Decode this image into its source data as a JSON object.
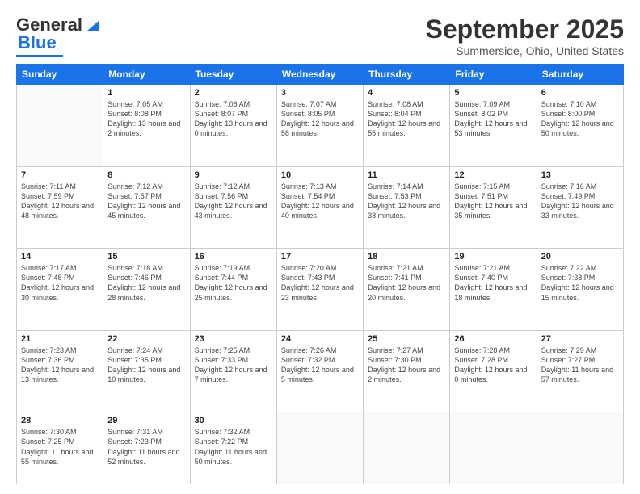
{
  "logo": {
    "line1": "General",
    "line2": "Blue"
  },
  "header": {
    "month": "September 2025",
    "location": "Summerside, Ohio, United States"
  },
  "days": [
    "Sunday",
    "Monday",
    "Tuesday",
    "Wednesday",
    "Thursday",
    "Friday",
    "Saturday"
  ],
  "weeks": [
    [
      {
        "num": "",
        "sunrise": "",
        "sunset": "",
        "daylight": ""
      },
      {
        "num": "1",
        "sunrise": "Sunrise: 7:05 AM",
        "sunset": "Sunset: 8:08 PM",
        "daylight": "Daylight: 13 hours and 2 minutes."
      },
      {
        "num": "2",
        "sunrise": "Sunrise: 7:06 AM",
        "sunset": "Sunset: 8:07 PM",
        "daylight": "Daylight: 13 hours and 0 minutes."
      },
      {
        "num": "3",
        "sunrise": "Sunrise: 7:07 AM",
        "sunset": "Sunset: 8:05 PM",
        "daylight": "Daylight: 12 hours and 58 minutes."
      },
      {
        "num": "4",
        "sunrise": "Sunrise: 7:08 AM",
        "sunset": "Sunset: 8:04 PM",
        "daylight": "Daylight: 12 hours and 55 minutes."
      },
      {
        "num": "5",
        "sunrise": "Sunrise: 7:09 AM",
        "sunset": "Sunset: 8:02 PM",
        "daylight": "Daylight: 12 hours and 53 minutes."
      },
      {
        "num": "6",
        "sunrise": "Sunrise: 7:10 AM",
        "sunset": "Sunset: 8:00 PM",
        "daylight": "Daylight: 12 hours and 50 minutes."
      }
    ],
    [
      {
        "num": "7",
        "sunrise": "Sunrise: 7:11 AM",
        "sunset": "Sunset: 7:59 PM",
        "daylight": "Daylight: 12 hours and 48 minutes."
      },
      {
        "num": "8",
        "sunrise": "Sunrise: 7:12 AM",
        "sunset": "Sunset: 7:57 PM",
        "daylight": "Daylight: 12 hours and 45 minutes."
      },
      {
        "num": "9",
        "sunrise": "Sunrise: 7:12 AM",
        "sunset": "Sunset: 7:56 PM",
        "daylight": "Daylight: 12 hours and 43 minutes."
      },
      {
        "num": "10",
        "sunrise": "Sunrise: 7:13 AM",
        "sunset": "Sunset: 7:54 PM",
        "daylight": "Daylight: 12 hours and 40 minutes."
      },
      {
        "num": "11",
        "sunrise": "Sunrise: 7:14 AM",
        "sunset": "Sunset: 7:53 PM",
        "daylight": "Daylight: 12 hours and 38 minutes."
      },
      {
        "num": "12",
        "sunrise": "Sunrise: 7:15 AM",
        "sunset": "Sunset: 7:51 PM",
        "daylight": "Daylight: 12 hours and 35 minutes."
      },
      {
        "num": "13",
        "sunrise": "Sunrise: 7:16 AM",
        "sunset": "Sunset: 7:49 PM",
        "daylight": "Daylight: 12 hours and 33 minutes."
      }
    ],
    [
      {
        "num": "14",
        "sunrise": "Sunrise: 7:17 AM",
        "sunset": "Sunset: 7:48 PM",
        "daylight": "Daylight: 12 hours and 30 minutes."
      },
      {
        "num": "15",
        "sunrise": "Sunrise: 7:18 AM",
        "sunset": "Sunset: 7:46 PM",
        "daylight": "Daylight: 12 hours and 28 minutes."
      },
      {
        "num": "16",
        "sunrise": "Sunrise: 7:19 AM",
        "sunset": "Sunset: 7:44 PM",
        "daylight": "Daylight: 12 hours and 25 minutes."
      },
      {
        "num": "17",
        "sunrise": "Sunrise: 7:20 AM",
        "sunset": "Sunset: 7:43 PM",
        "daylight": "Daylight: 12 hours and 23 minutes."
      },
      {
        "num": "18",
        "sunrise": "Sunrise: 7:21 AM",
        "sunset": "Sunset: 7:41 PM",
        "daylight": "Daylight: 12 hours and 20 minutes."
      },
      {
        "num": "19",
        "sunrise": "Sunrise: 7:21 AM",
        "sunset": "Sunset: 7:40 PM",
        "daylight": "Daylight: 12 hours and 18 minutes."
      },
      {
        "num": "20",
        "sunrise": "Sunrise: 7:22 AM",
        "sunset": "Sunset: 7:38 PM",
        "daylight": "Daylight: 12 hours and 15 minutes."
      }
    ],
    [
      {
        "num": "21",
        "sunrise": "Sunrise: 7:23 AM",
        "sunset": "Sunset: 7:36 PM",
        "daylight": "Daylight: 12 hours and 13 minutes."
      },
      {
        "num": "22",
        "sunrise": "Sunrise: 7:24 AM",
        "sunset": "Sunset: 7:35 PM",
        "daylight": "Daylight: 12 hours and 10 minutes."
      },
      {
        "num": "23",
        "sunrise": "Sunrise: 7:25 AM",
        "sunset": "Sunset: 7:33 PM",
        "daylight": "Daylight: 12 hours and 7 minutes."
      },
      {
        "num": "24",
        "sunrise": "Sunrise: 7:26 AM",
        "sunset": "Sunset: 7:32 PM",
        "daylight": "Daylight: 12 hours and 5 minutes."
      },
      {
        "num": "25",
        "sunrise": "Sunrise: 7:27 AM",
        "sunset": "Sunset: 7:30 PM",
        "daylight": "Daylight: 12 hours and 2 minutes."
      },
      {
        "num": "26",
        "sunrise": "Sunrise: 7:28 AM",
        "sunset": "Sunset: 7:28 PM",
        "daylight": "Daylight: 12 hours and 0 minutes."
      },
      {
        "num": "27",
        "sunrise": "Sunrise: 7:29 AM",
        "sunset": "Sunset: 7:27 PM",
        "daylight": "Daylight: 11 hours and 57 minutes."
      }
    ],
    [
      {
        "num": "28",
        "sunrise": "Sunrise: 7:30 AM",
        "sunset": "Sunset: 7:25 PM",
        "daylight": "Daylight: 11 hours and 55 minutes."
      },
      {
        "num": "29",
        "sunrise": "Sunrise: 7:31 AM",
        "sunset": "Sunset: 7:23 PM",
        "daylight": "Daylight: 11 hours and 52 minutes."
      },
      {
        "num": "30",
        "sunrise": "Sunrise: 7:32 AM",
        "sunset": "Sunset: 7:22 PM",
        "daylight": "Daylight: 11 hours and 50 minutes."
      },
      {
        "num": "",
        "sunrise": "",
        "sunset": "",
        "daylight": ""
      },
      {
        "num": "",
        "sunrise": "",
        "sunset": "",
        "daylight": ""
      },
      {
        "num": "",
        "sunrise": "",
        "sunset": "",
        "daylight": ""
      },
      {
        "num": "",
        "sunrise": "",
        "sunset": "",
        "daylight": ""
      }
    ]
  ]
}
